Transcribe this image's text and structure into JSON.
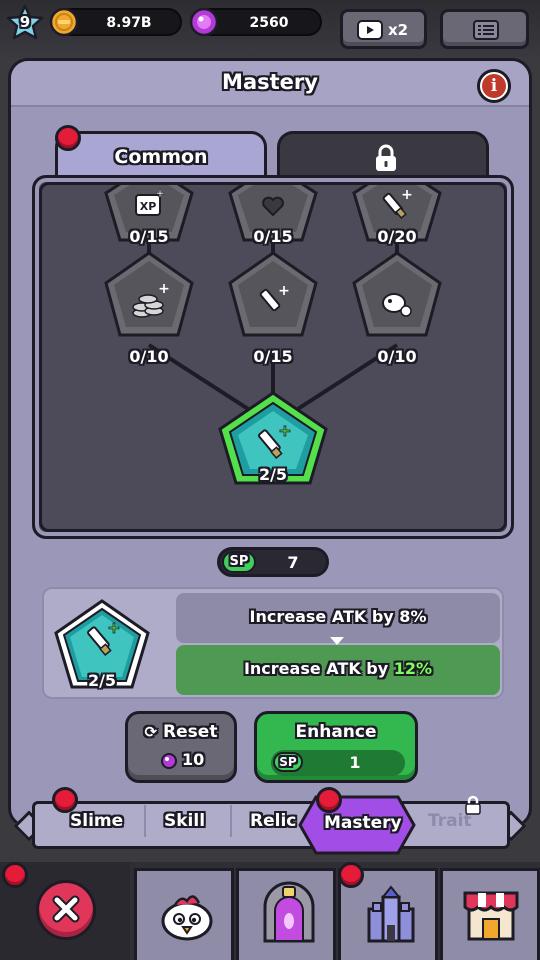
{
  "header": {
    "level": "9",
    "gold": "8.97B",
    "gems": "2560",
    "ad_button_label": "x2",
    "colors": {
      "gold": "#f0a92e",
      "gem": "#b23ad6"
    }
  },
  "panel": {
    "title": "Mastery",
    "info_icon": "info-icon",
    "tabs": [
      {
        "label": "Common",
        "active": true,
        "badge": true
      },
      {
        "label": "",
        "locked": true,
        "icon": "lock-icon"
      }
    ]
  },
  "tree": {
    "nodes": [
      {
        "id": "xp",
        "icon": "xp-plus-icon",
        "progress": "0/15",
        "tier": 1
      },
      {
        "id": "heart",
        "icon": "heart-icon",
        "progress": "0/15",
        "tier": 1
      },
      {
        "id": "sword-top",
        "icon": "sword-plus-icon",
        "progress": "0/20",
        "tier": 1
      },
      {
        "id": "coins",
        "icon": "coins-plus-icon",
        "progress": "0/10",
        "tier": 2
      },
      {
        "id": "sword-mid",
        "icon": "sword-plus-icon",
        "progress": "0/15",
        "tier": 2
      },
      {
        "id": "pet",
        "icon": "pet-icon",
        "progress": "0/10",
        "tier": 2
      },
      {
        "id": "root",
        "icon": "sword-plus-icon",
        "progress": "2/5",
        "tier": 3,
        "selected": true
      }
    ]
  },
  "sp": {
    "badge": "SP",
    "value": "7"
  },
  "detail": {
    "progress": "2/5",
    "current_text": "Increase ATK by 8%",
    "next_prefix": "Increase ATK by ",
    "next_value": "12%"
  },
  "actions": {
    "reset_label": "Reset",
    "reset_cost": "10",
    "enhance_label": "Enhance",
    "enhance_badge": "SP",
    "enhance_cost": "1"
  },
  "categories": [
    {
      "label": "Slime"
    },
    {
      "label": "Skill"
    },
    {
      "label": "Relic"
    },
    {
      "label": "Mastery",
      "active": true
    },
    {
      "label": "Trait",
      "locked": true
    }
  ],
  "bottom_nav": [
    {
      "icon": "close-icon"
    },
    {
      "icon": "chicken-icon"
    },
    {
      "icon": "portal-icon"
    },
    {
      "icon": "castle-icon"
    },
    {
      "icon": "shop-icon"
    }
  ]
}
